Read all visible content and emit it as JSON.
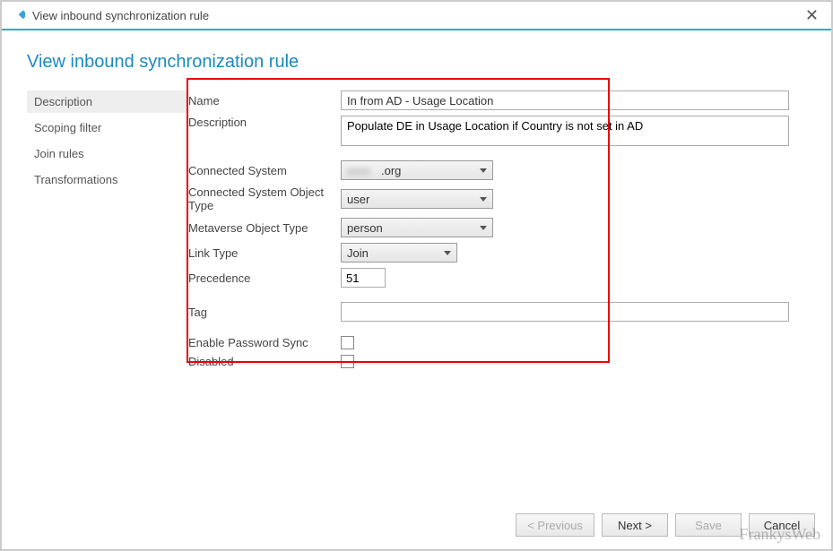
{
  "titlebar": {
    "title": "View inbound synchronization rule"
  },
  "page": {
    "title": "View inbound synchronization rule"
  },
  "sidebar": {
    "items": [
      {
        "label": "Description",
        "selected": true
      },
      {
        "label": "Scoping filter",
        "selected": false
      },
      {
        "label": "Join rules",
        "selected": false
      },
      {
        "label": "Transformations",
        "selected": false
      }
    ]
  },
  "form": {
    "name_label": "Name",
    "name_value": "In from AD - Usage Location",
    "description_label": "Description",
    "description_value": "Populate DE in Usage Location if Country is not set in AD",
    "connected_system_label": "Connected System",
    "connected_system_value_suffix": ".org",
    "cs_object_type_label": "Connected System Object Type",
    "cs_object_type_value": "user",
    "mv_object_type_label": "Metaverse Object Type",
    "mv_object_type_value": "person",
    "link_type_label": "Link Type",
    "link_type_value": "Join",
    "precedence_label": "Precedence",
    "precedence_value": "51",
    "tag_label": "Tag",
    "tag_value": "",
    "enable_pwd_sync_label": "Enable Password Sync",
    "enable_pwd_sync_checked": false,
    "disabled_label": "Disabled",
    "disabled_checked": false
  },
  "footer": {
    "previous": "< Previous",
    "next": "Next >",
    "save": "Save",
    "cancel": "Cancel"
  },
  "watermark": "FrankysWeb"
}
